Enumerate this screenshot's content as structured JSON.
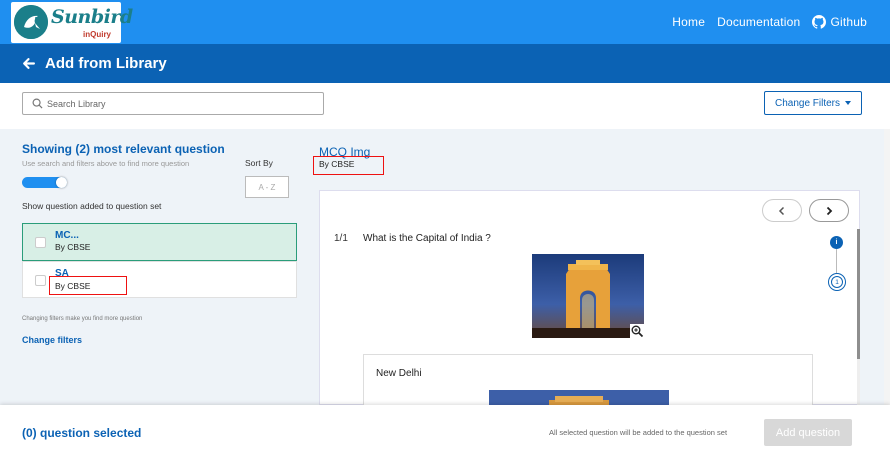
{
  "header": {
    "logo_text": "Sunbird",
    "logo_sub": "inQuiry",
    "nav": [
      {
        "label": "Home"
      },
      {
        "label": "Documentation"
      },
      {
        "label": "Github"
      }
    ]
  },
  "titlebar": {
    "title": "Add from Library"
  },
  "search": {
    "placeholder": "Search Library"
  },
  "filters": {
    "label": "Change Filters"
  },
  "left": {
    "showing": "Showing (2) most relevant question",
    "hint": "Use search and filters above to find more question",
    "sort_label": "Sort By",
    "sort_value": "A - Z",
    "toggle_on": true,
    "show_added": "Show question added to question set",
    "questions": [
      {
        "title": "MC...",
        "by": "By CBSE",
        "selected": true
      },
      {
        "title": "SA",
        "by": "By CBSE",
        "selected": false
      }
    ],
    "changing_note": "Changing filters make you find more question",
    "change_filters": "Change filters"
  },
  "preview": {
    "title": "MCQ Img",
    "by": "By CBSE",
    "counter": "1/1",
    "question": "What is the Capital of India ?",
    "option": "New Delhi",
    "step_info": "i",
    "step_number": "1"
  },
  "footer": {
    "selected_count": "(0) question selected",
    "note": "All selected question will be added to the question set",
    "add_label": "Add question"
  },
  "colors": {
    "topbar": "#1f8ff0",
    "titlebar": "#0b62b4",
    "accent": "#0b62b4",
    "selected_card": "#d8efe6",
    "highlight": "#ee1111"
  }
}
